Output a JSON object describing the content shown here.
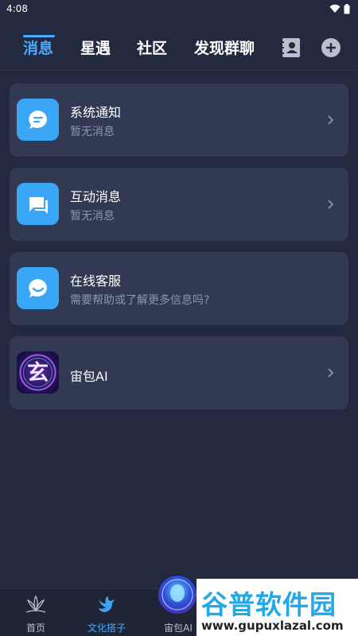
{
  "status_bar": {
    "time": "4:08"
  },
  "top_tabs": [
    {
      "label": "消息",
      "active": true
    },
    {
      "label": "星遇",
      "active": false
    },
    {
      "label": "社区",
      "active": false
    },
    {
      "label": "发现群聊",
      "active": false
    }
  ],
  "cards": [
    {
      "title": "系统通知",
      "subtitle": "暂无消息",
      "icon": "chat-bubble-lines-icon",
      "has_chevron": true
    },
    {
      "title": "互动消息",
      "subtitle": "暂无消息",
      "icon": "chat-square-icon",
      "has_chevron": true
    },
    {
      "title": "在线客服",
      "subtitle": "需要帮助或了解更多信息吗?",
      "icon": "chat-smile-icon",
      "has_chevron": false
    },
    {
      "title": "宙包AI",
      "subtitle": "",
      "icon": "xuan-avatar",
      "avatar_char": "玄",
      "has_chevron": true
    }
  ],
  "bottom_nav": [
    {
      "label": "首页",
      "icon": "lotus-icon",
      "active": false
    },
    {
      "label": "文化搭子",
      "icon": "bird-icon",
      "active": true
    },
    {
      "label": "宙包AI",
      "icon": "ai-orb-icon",
      "active": false
    }
  ],
  "watermark": {
    "title": "谷普软件园",
    "url": "www.gupuxlazal.com"
  },
  "colors": {
    "background": "#232a3f",
    "card": "#313a52",
    "accent": "#4aa8ff",
    "icon_box": "#3ba6f6",
    "subtext": "#8d96ab"
  }
}
